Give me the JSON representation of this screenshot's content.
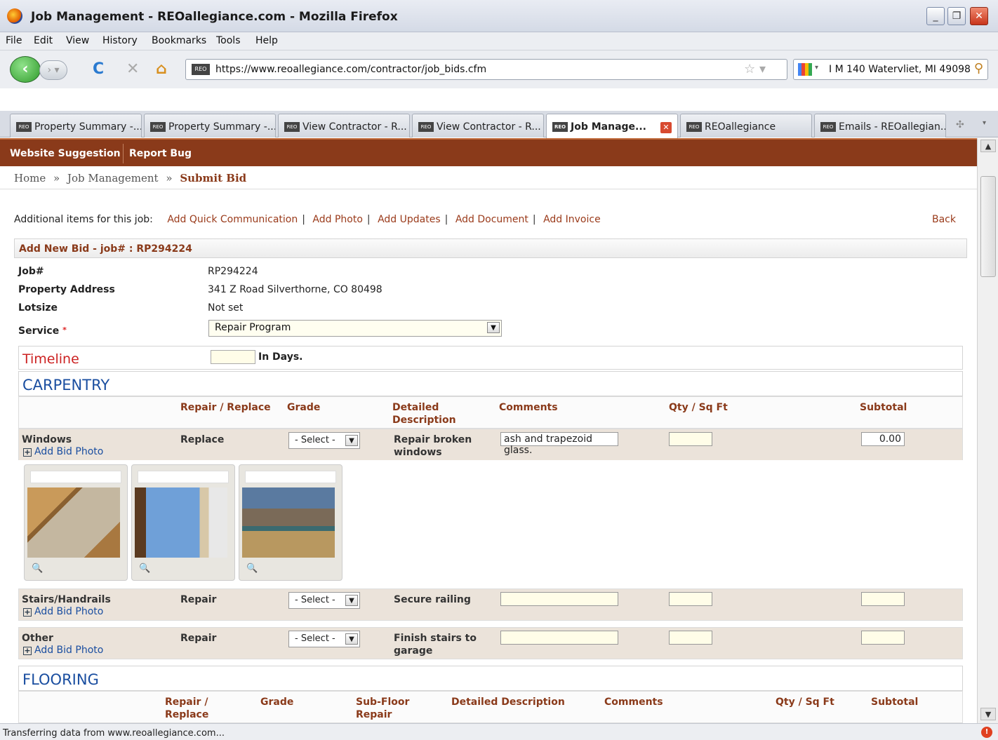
{
  "window": {
    "title": "Job Management - REOallegiance.com - Mozilla Firefox"
  },
  "menu": [
    "File",
    "Edit",
    "View",
    "History",
    "Bookmarks",
    "Tools",
    "Help"
  ],
  "nav": {
    "url": "https://www.reoallegiance.com/contractor/job_bids.cfm",
    "search": "I M 140  Watervliet, MI 49098",
    "favicon": "REO"
  },
  "tabs": [
    {
      "label": "Property Summary -..."
    },
    {
      "label": "Property Summary -..."
    },
    {
      "label": "View Contractor - R..."
    },
    {
      "label": "View Contractor - R..."
    },
    {
      "label": "Job Manage..."
    },
    {
      "label": "REOallegiance"
    },
    {
      "label": "Emails - REOallegian..."
    }
  ],
  "site": {
    "topnav": [
      "Website Suggestion",
      "Report Bug"
    ],
    "breadcrumb": {
      "home": "Home",
      "sep": "»",
      "mid": "Job Management",
      "current": "Submit Bid"
    },
    "additional_label": "Additional items for this job:",
    "additional_links": [
      "Add Quick Communication",
      "Add Photo",
      "Add Updates",
      "Add Document",
      "Add Invoice"
    ],
    "back": "Back"
  },
  "form": {
    "title": "Add New Bid - job# : RP294224",
    "job_label": "Job#",
    "job_value": "RP294224",
    "addr_label": "Property Address",
    "addr_value": "341 Z Road Silverthorne, CO 80498",
    "lot_label": "Lotsize",
    "lot_value": "Not set",
    "service_label": "Service",
    "service_required": "*",
    "service_value": "Repair Program",
    "timeline_label": "Timeline",
    "timeline_unit": "In Days."
  },
  "carpentry": {
    "title": "CARPENTRY",
    "headers": [
      "Repair / Replace",
      "Grade",
      "Detailed Description",
      "Comments",
      "Qty / Sq Ft",
      "Subtotal"
    ],
    "add_photo": "Add Bid Photo",
    "select_label": "- Select -",
    "rows": [
      {
        "item": "Windows",
        "action": "Replace",
        "desc": "Repair broken windows",
        "comment": "ash and trapezoid glass.",
        "qty": "",
        "subtotal": "0.00"
      },
      {
        "item": "Stairs/Handrails",
        "action": "Repair",
        "desc": "Secure railing",
        "comment": "",
        "qty": "",
        "subtotal": ""
      },
      {
        "item": "Other",
        "action": "Repair",
        "desc": "Finish stairs to garage",
        "comment": "",
        "qty": "",
        "subtotal": ""
      }
    ]
  },
  "flooring": {
    "title": "FLOORING",
    "headers": [
      "Repair / Replace",
      "Grade",
      "Sub-Floor Repair",
      "Detailed Description",
      "Comments",
      "Qty / Sq Ft",
      "Subtotal"
    ]
  },
  "status": "Transferring data from www.reoallegiance.com..."
}
